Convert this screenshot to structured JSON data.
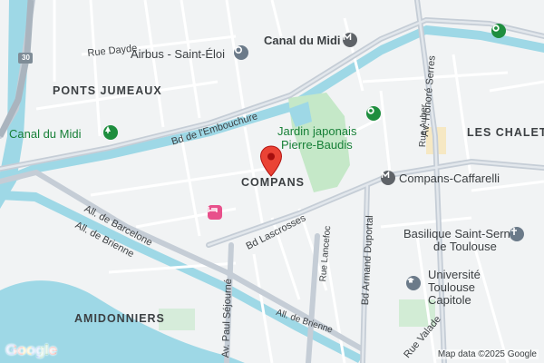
{
  "districts": {
    "ponts_jumeaux": "PONTS JUMEAUX",
    "les_chalets": "LES CHALETS",
    "compans": "COMPANS",
    "amidonniers": "AMIDONNIERS"
  },
  "pois": {
    "airbus": "Airbus - Saint-Éloi",
    "canal_du_midi_top": "Canal du Midi",
    "canal_du_midi_left": "Canal du Midi",
    "jardin_line1": "Jardin japonais",
    "jardin_line2": "Pierre-Baudis",
    "compans_caffarelli": "Compans-Caffarelli",
    "basilique_line1": "Basilique Saint-Sernin",
    "basilique_line2": "de Toulouse",
    "universite_line1": "Université",
    "universite_line2": "Toulouse",
    "universite_line3": "Capitole"
  },
  "roads": {
    "rue_dayde": "Rue Dayde",
    "bd_embouchure": "Bd de l'Embouchure",
    "av_honore_serres": "Av. Honoré Serres",
    "rue_auber": "Rue Auber",
    "all_barcelone": "All. de Barcelone",
    "all_brienne": "All. de Brienne",
    "bd_lascrosses": "Bd Lascrosses",
    "rue_lancefoc": "Rue Lancefoc",
    "bd_armand_duportal": "Bd Armand Duportal",
    "av_paul_sejourne": "Av. Paul Séjourné",
    "all_brienne_2": "All. de Brienne",
    "rue_valade": "Rue Valade",
    "route_30": "30"
  },
  "attribution": "Map data ©2025 Google",
  "logo": "Google",
  "colors": {
    "water": "#9ed8e6",
    "park": "#c5e8c8",
    "major_road": "#c5cdd6",
    "minor_road": "#ffffff",
    "pin": "#ea4335",
    "metro": "#5f6368",
    "poi_blue": "#5f6368",
    "poi_green": "#1e8e3e",
    "hotel": "#e8508b"
  },
  "icons": {
    "pin": "location-pin-icon",
    "metro": "metro-icon",
    "landmark": "landmark-icon",
    "park": "park-icon",
    "hotel": "hotel-icon",
    "worship": "church-icon",
    "university": "university-icon"
  }
}
